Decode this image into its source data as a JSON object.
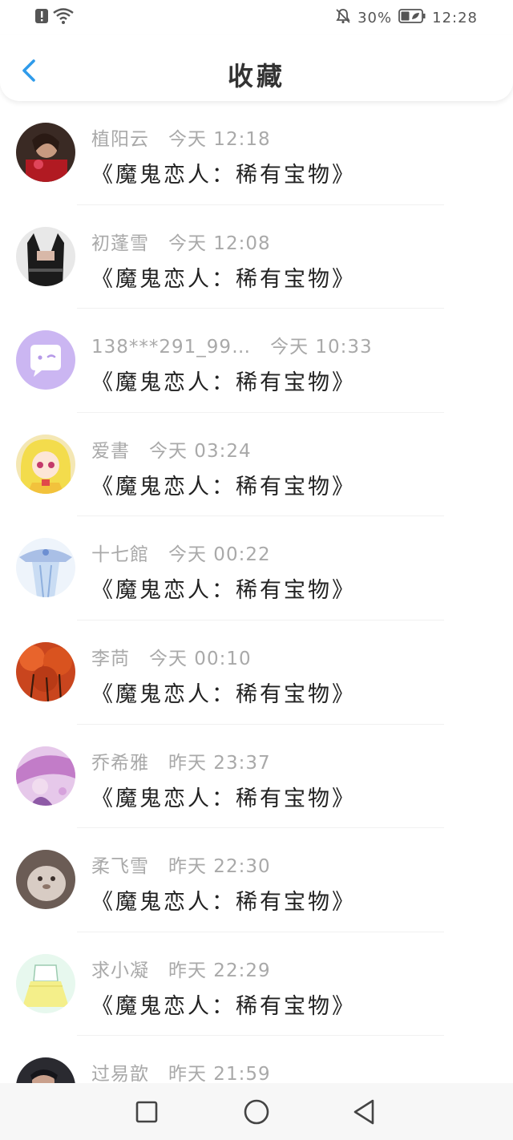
{
  "status_bar": {
    "battery": "30%",
    "time": "12:28",
    "icons": [
      "alert-icon",
      "wifi-icon",
      "mute-icon",
      "battery-icon"
    ]
  },
  "header": {
    "title": "收藏",
    "back_icon": "chevron-left-icon"
  },
  "colors": {
    "accent": "#2f9bea",
    "meta_text": "#a9a9a9",
    "title_text": "#222222"
  },
  "items": [
    {
      "name": "植阳云",
      "time": "今天 12:18",
      "title": "《魔鬼恋人：稀有宝物》"
    },
    {
      "name": "初蓬雪",
      "time": "今天 12:08",
      "title": "《魔鬼恋人：稀有宝物》"
    },
    {
      "name": "138***291_99…",
      "time": "今天 10:33",
      "title": "《魔鬼恋人：稀有宝物》"
    },
    {
      "name": "爱書",
      "time": "今天 03:24",
      "title": "《魔鬼恋人：稀有宝物》"
    },
    {
      "name": "十七館",
      "time": "今天 00:22",
      "title": "《魔鬼恋人：稀有宝物》"
    },
    {
      "name": "李苘",
      "time": "今天 00:10",
      "title": "《魔鬼恋人：稀有宝物》"
    },
    {
      "name": "乔希雅",
      "time": "昨天 23:37",
      "title": "《魔鬼恋人：稀有宝物》"
    },
    {
      "name": "柔飞雪",
      "time": "昨天 22:30",
      "title": "《魔鬼恋人：稀有宝物》"
    },
    {
      "name": "求小凝",
      "time": "昨天 22:29",
      "title": "《魔鬼恋人：稀有宝物》"
    },
    {
      "name": "过易歆",
      "time": "昨天 21:59",
      "title": ""
    }
  ],
  "nav": {
    "icons": [
      "square-recents-icon",
      "circle-home-icon",
      "triangle-back-icon"
    ]
  }
}
